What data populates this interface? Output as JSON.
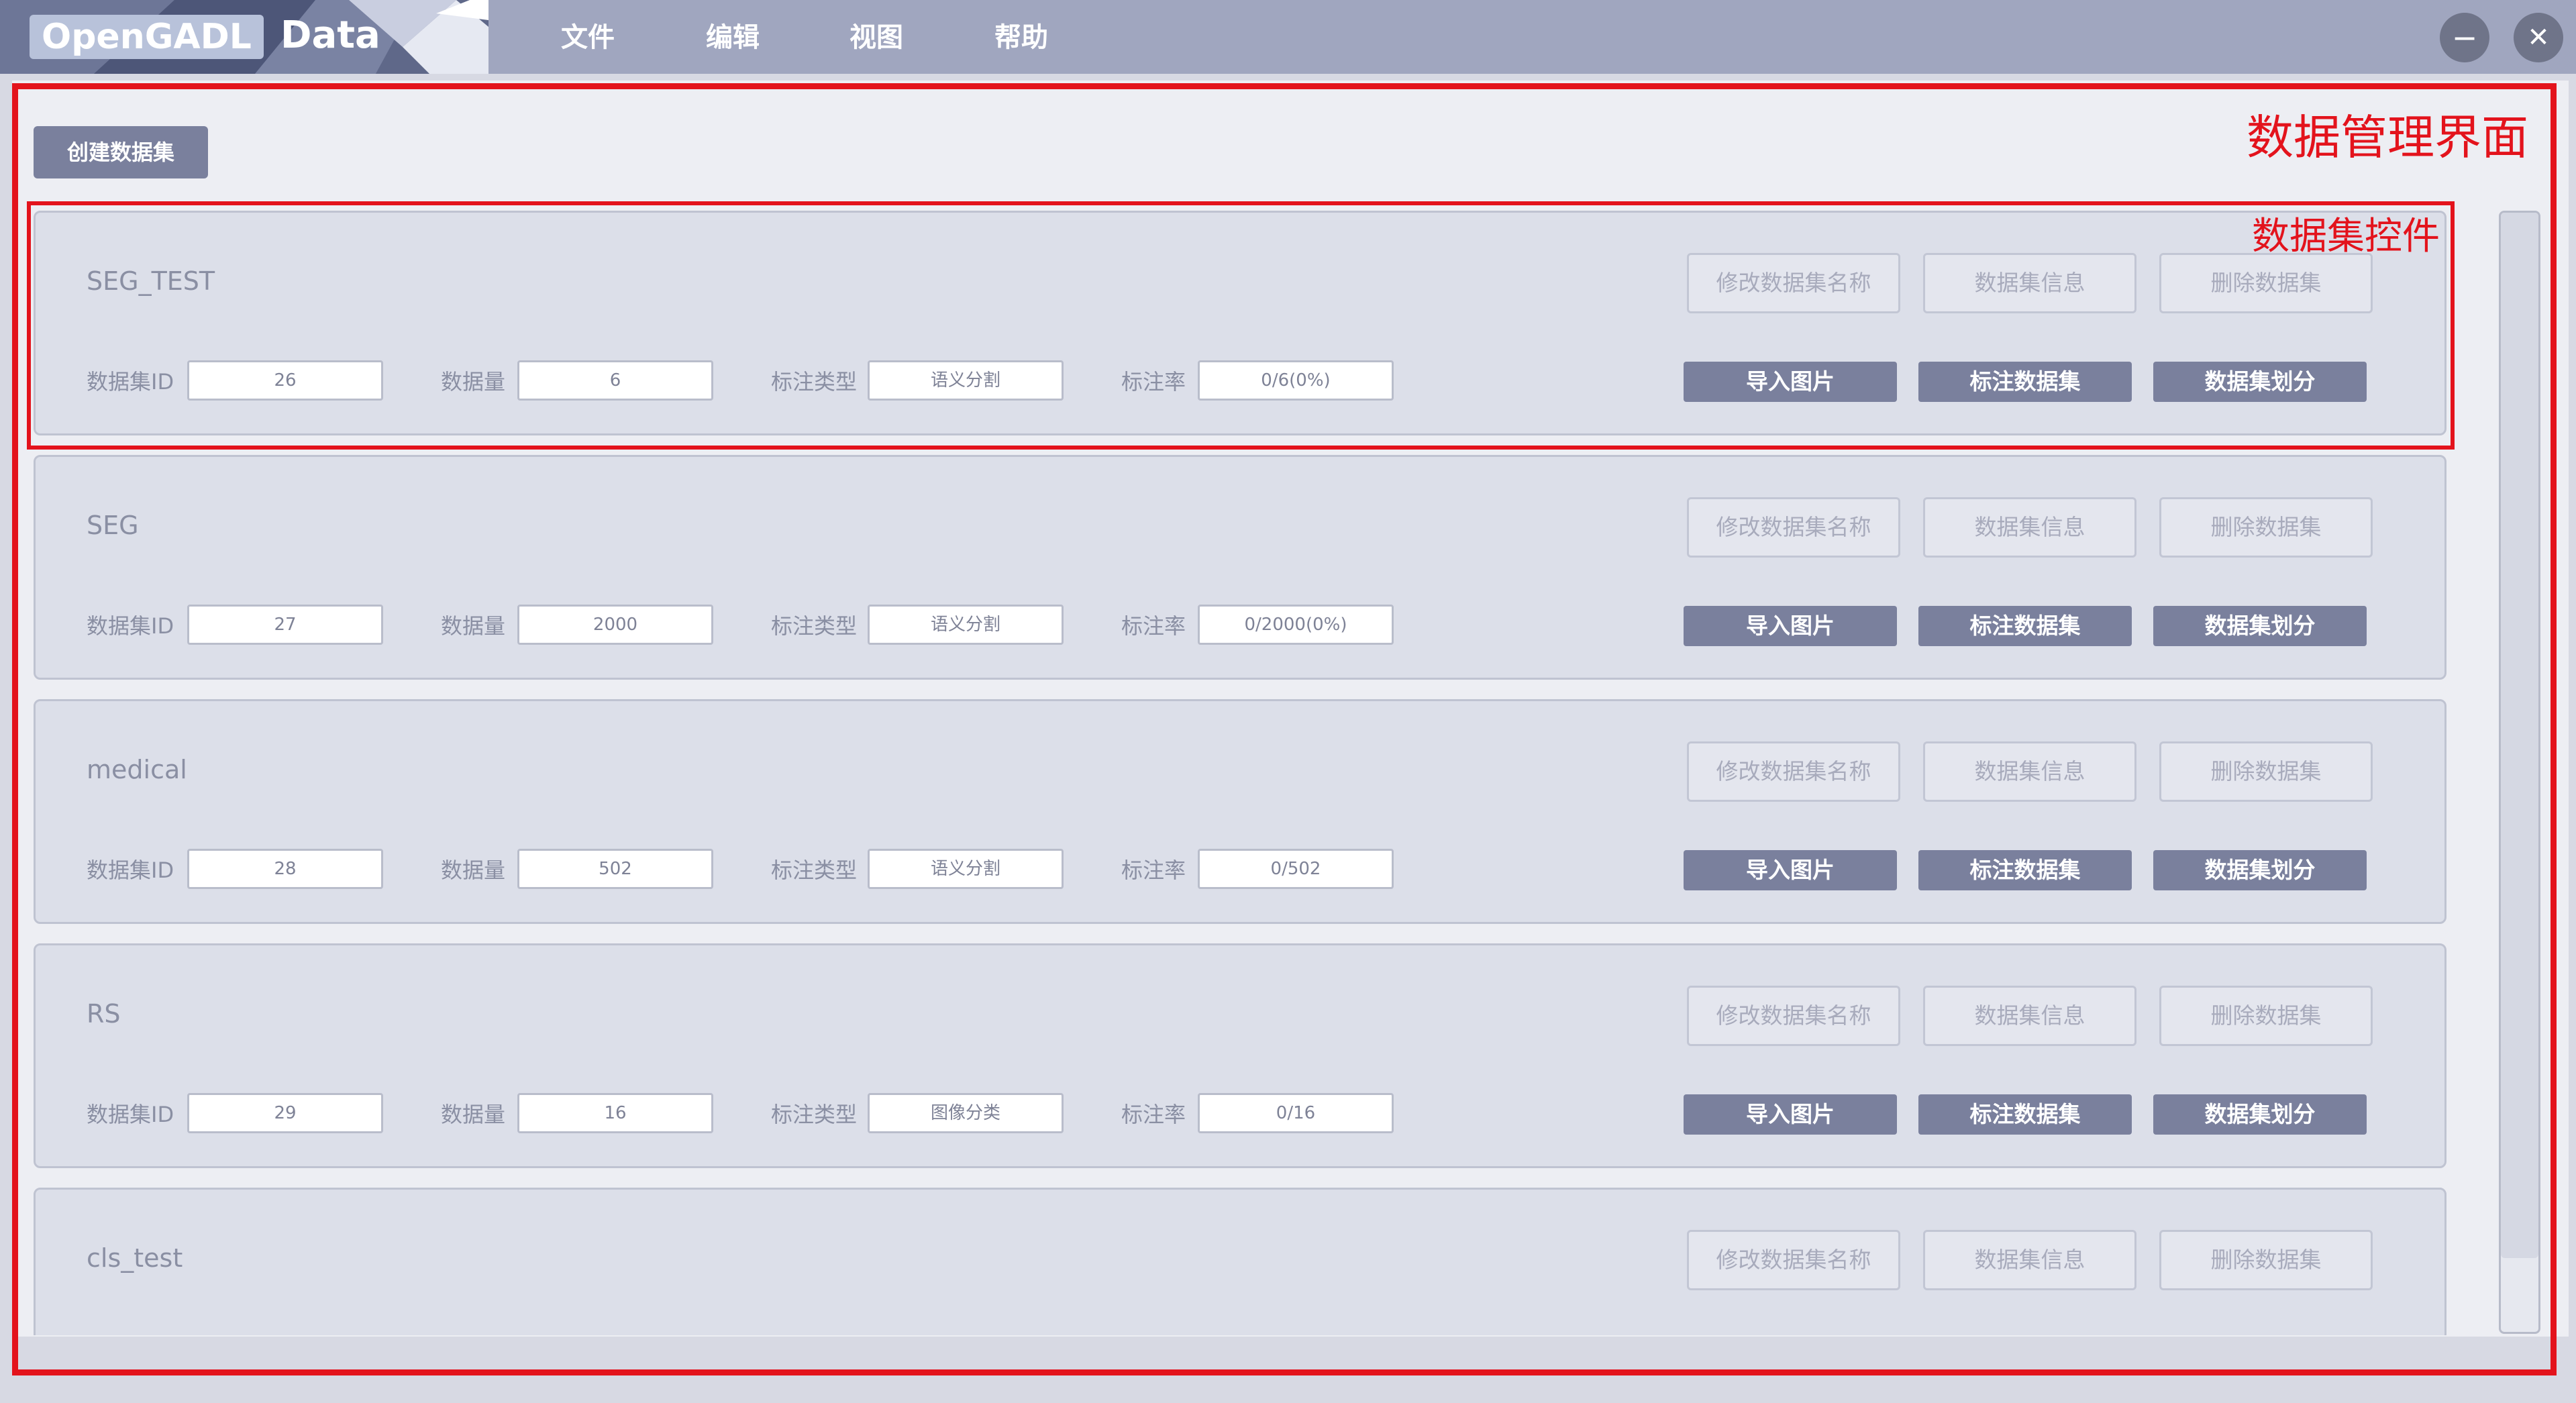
{
  "app": {
    "logo_name": "OpenGADL",
    "logo_suffix": "Data",
    "menu": [
      "文件",
      "编辑",
      "视图",
      "帮助"
    ],
    "minimize_glyph": "−",
    "close_glyph": "✕"
  },
  "annotations": {
    "outer_label": "数据管理界面",
    "inner_label": "数据集控件"
  },
  "toolbar": {
    "create_label": "创建数据集"
  },
  "field_labels": {
    "id": "数据集ID",
    "count": "数据量",
    "type": "标注类型",
    "rate": "标注率"
  },
  "buttons": {
    "rename": "修改数据集名称",
    "info": "数据集信息",
    "delete": "删除数据集",
    "import": "导入图片",
    "annotate": "标注数据集",
    "split": "数据集划分"
  },
  "datasets": [
    {
      "name": "SEG_TEST",
      "id": "26",
      "count": "6",
      "type": "语义分割",
      "rate": "0/6(0%)"
    },
    {
      "name": "SEG",
      "id": "27",
      "count": "2000",
      "type": "语义分割",
      "rate": "0/2000(0%)"
    },
    {
      "name": "medical",
      "id": "28",
      "count": "502",
      "type": "语义分割",
      "rate": "0/502"
    },
    {
      "name": "RS",
      "id": "29",
      "count": "16",
      "type": "图像分类",
      "rate": "0/16"
    },
    {
      "name": "cls_test"
    }
  ],
  "colors": {
    "annotation": "#e3131c",
    "titlebar": "#a0a6bf",
    "button_active": "#7a809d",
    "content_bg": "#edeef3"
  }
}
